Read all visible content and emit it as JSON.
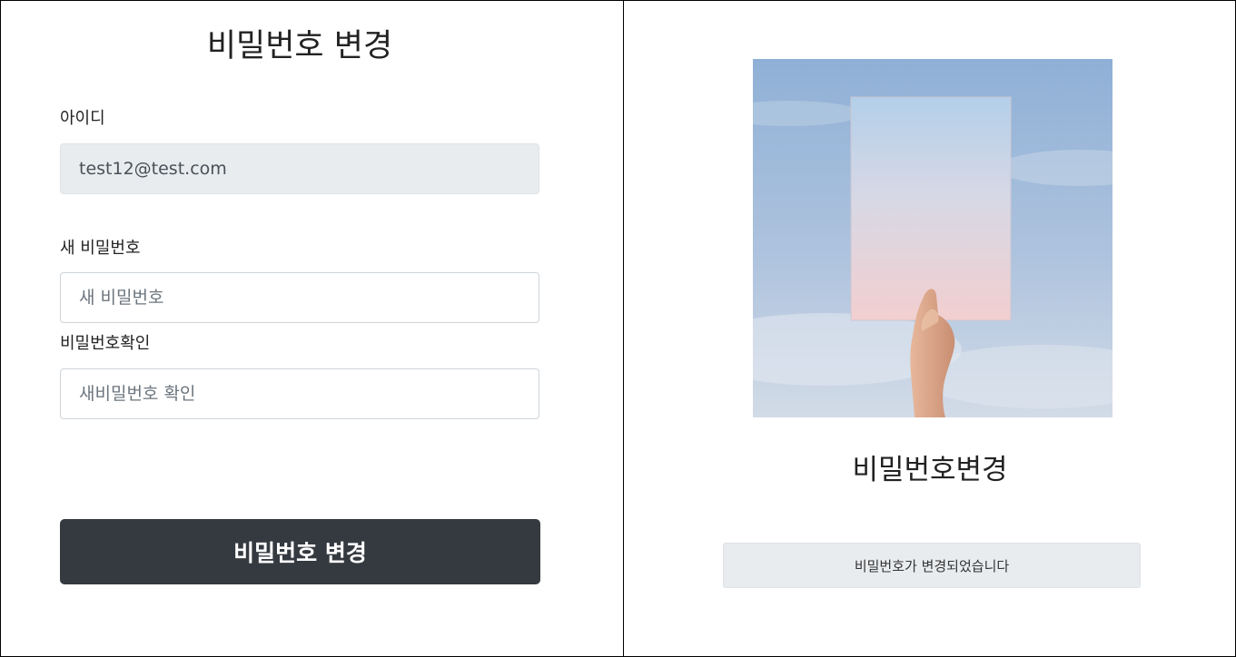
{
  "form": {
    "title": "비밀번호 변경",
    "id_label": "아이디",
    "id_value": "test12@test.com",
    "new_password_label": "새 비밀번호",
    "new_password_placeholder": "새 비밀번호",
    "confirm_label": "비밀번호확인",
    "confirm_placeholder": "새비밀번호 확인",
    "submit_label": "비밀번호 변경"
  },
  "result": {
    "image": "hand holding gradient paper against sky",
    "title": "비밀번호변경",
    "message": "비밀번호가 변경되었습니다"
  },
  "colors": {
    "button_bg": "#343a40",
    "readonly_bg": "#e9ecef",
    "border": "#ced4da"
  }
}
